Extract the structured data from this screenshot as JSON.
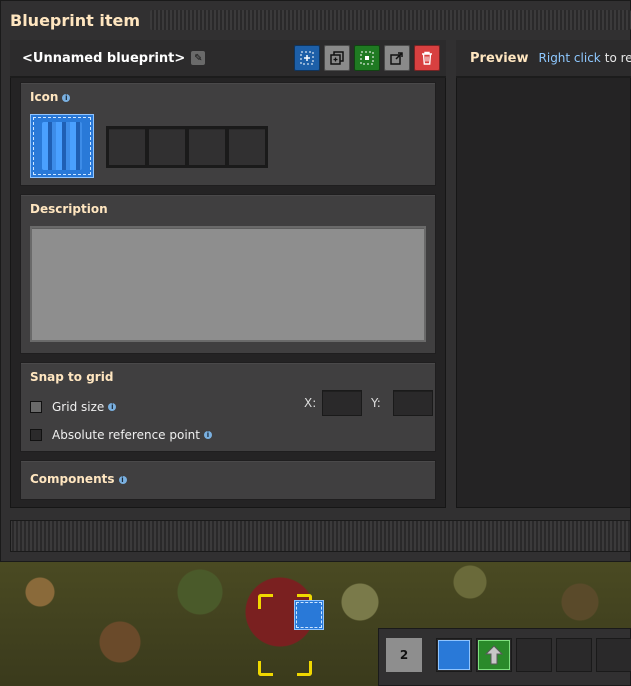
{
  "window": {
    "title": "Blueprint item"
  },
  "blueprint": {
    "name": "<Unnamed blueprint>",
    "edit_icon": "pencil-icon"
  },
  "toolbar": {
    "buttons": [
      {
        "icon": "select-area-icon",
        "color": "#1d5fa8"
      },
      {
        "icon": "copy-icon",
        "color": "#8a8a8a"
      },
      {
        "icon": "reselect-icon",
        "color": "#1f7a22"
      },
      {
        "icon": "export-icon",
        "color": "#8a8a8a"
      },
      {
        "icon": "trash-icon",
        "color": "#d84040"
      }
    ]
  },
  "icon_section": {
    "title": "Icon",
    "info_icon": "info-icon",
    "main_icon": "blueprint-icon",
    "slot_count": 4
  },
  "description_section": {
    "title": "Description",
    "value": ""
  },
  "snap_section": {
    "title": "Snap to grid",
    "grid_size_label": "Grid size",
    "grid_size_checked": false,
    "absolute_label": "Absolute reference point",
    "absolute_checked": false,
    "x_label": "X:",
    "y_label": "Y:",
    "x_value": "",
    "y_value": ""
  },
  "components_section": {
    "title": "Components"
  },
  "preview": {
    "title": "Preview",
    "hint_highlight": "Right click",
    "hint_rest": "to rem"
  },
  "quickbar": {
    "page_number": "2",
    "slots": [
      "blueprint-icon",
      "upgrade-planner-icon",
      "",
      "",
      ""
    ]
  },
  "colors": {
    "title_text": "#ffe6c0",
    "hint_blue": "#8ec8ff",
    "accent_blue": "#2979d8",
    "cursor_yellow": "#f0d800"
  }
}
